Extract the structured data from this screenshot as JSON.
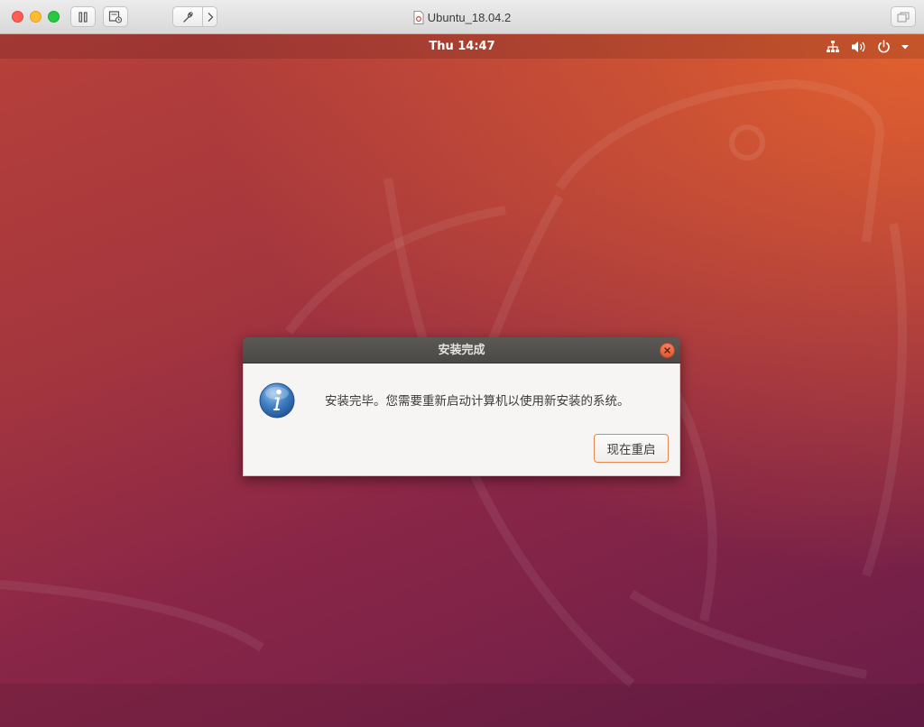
{
  "host_window": {
    "title": "Ubuntu_18.04.2",
    "controls": {
      "close_color": "#fd5f57",
      "minimize_color": "#febc2e",
      "zoom_color": "#28c840"
    },
    "toolbar_icons": [
      "pause-icon",
      "snapshot-icon",
      "wrench-icon",
      "chevron-right-icon",
      "fullscreen-icon"
    ]
  },
  "ubuntu_topbar": {
    "clock": "Thu 14:47",
    "tray_icons": [
      "network-icon",
      "volume-icon",
      "power-icon",
      "dropdown-arrow-icon"
    ]
  },
  "dialog": {
    "title": "安装完成",
    "message": "安装完毕。您需要重新启动计算机以使用新安装的系统。",
    "button_label": "现在重启",
    "icon": "info-icon"
  },
  "colors": {
    "accent_orange": "#e95420",
    "dialog_header": "#4f4e4b",
    "button_border": "#e2884f"
  }
}
